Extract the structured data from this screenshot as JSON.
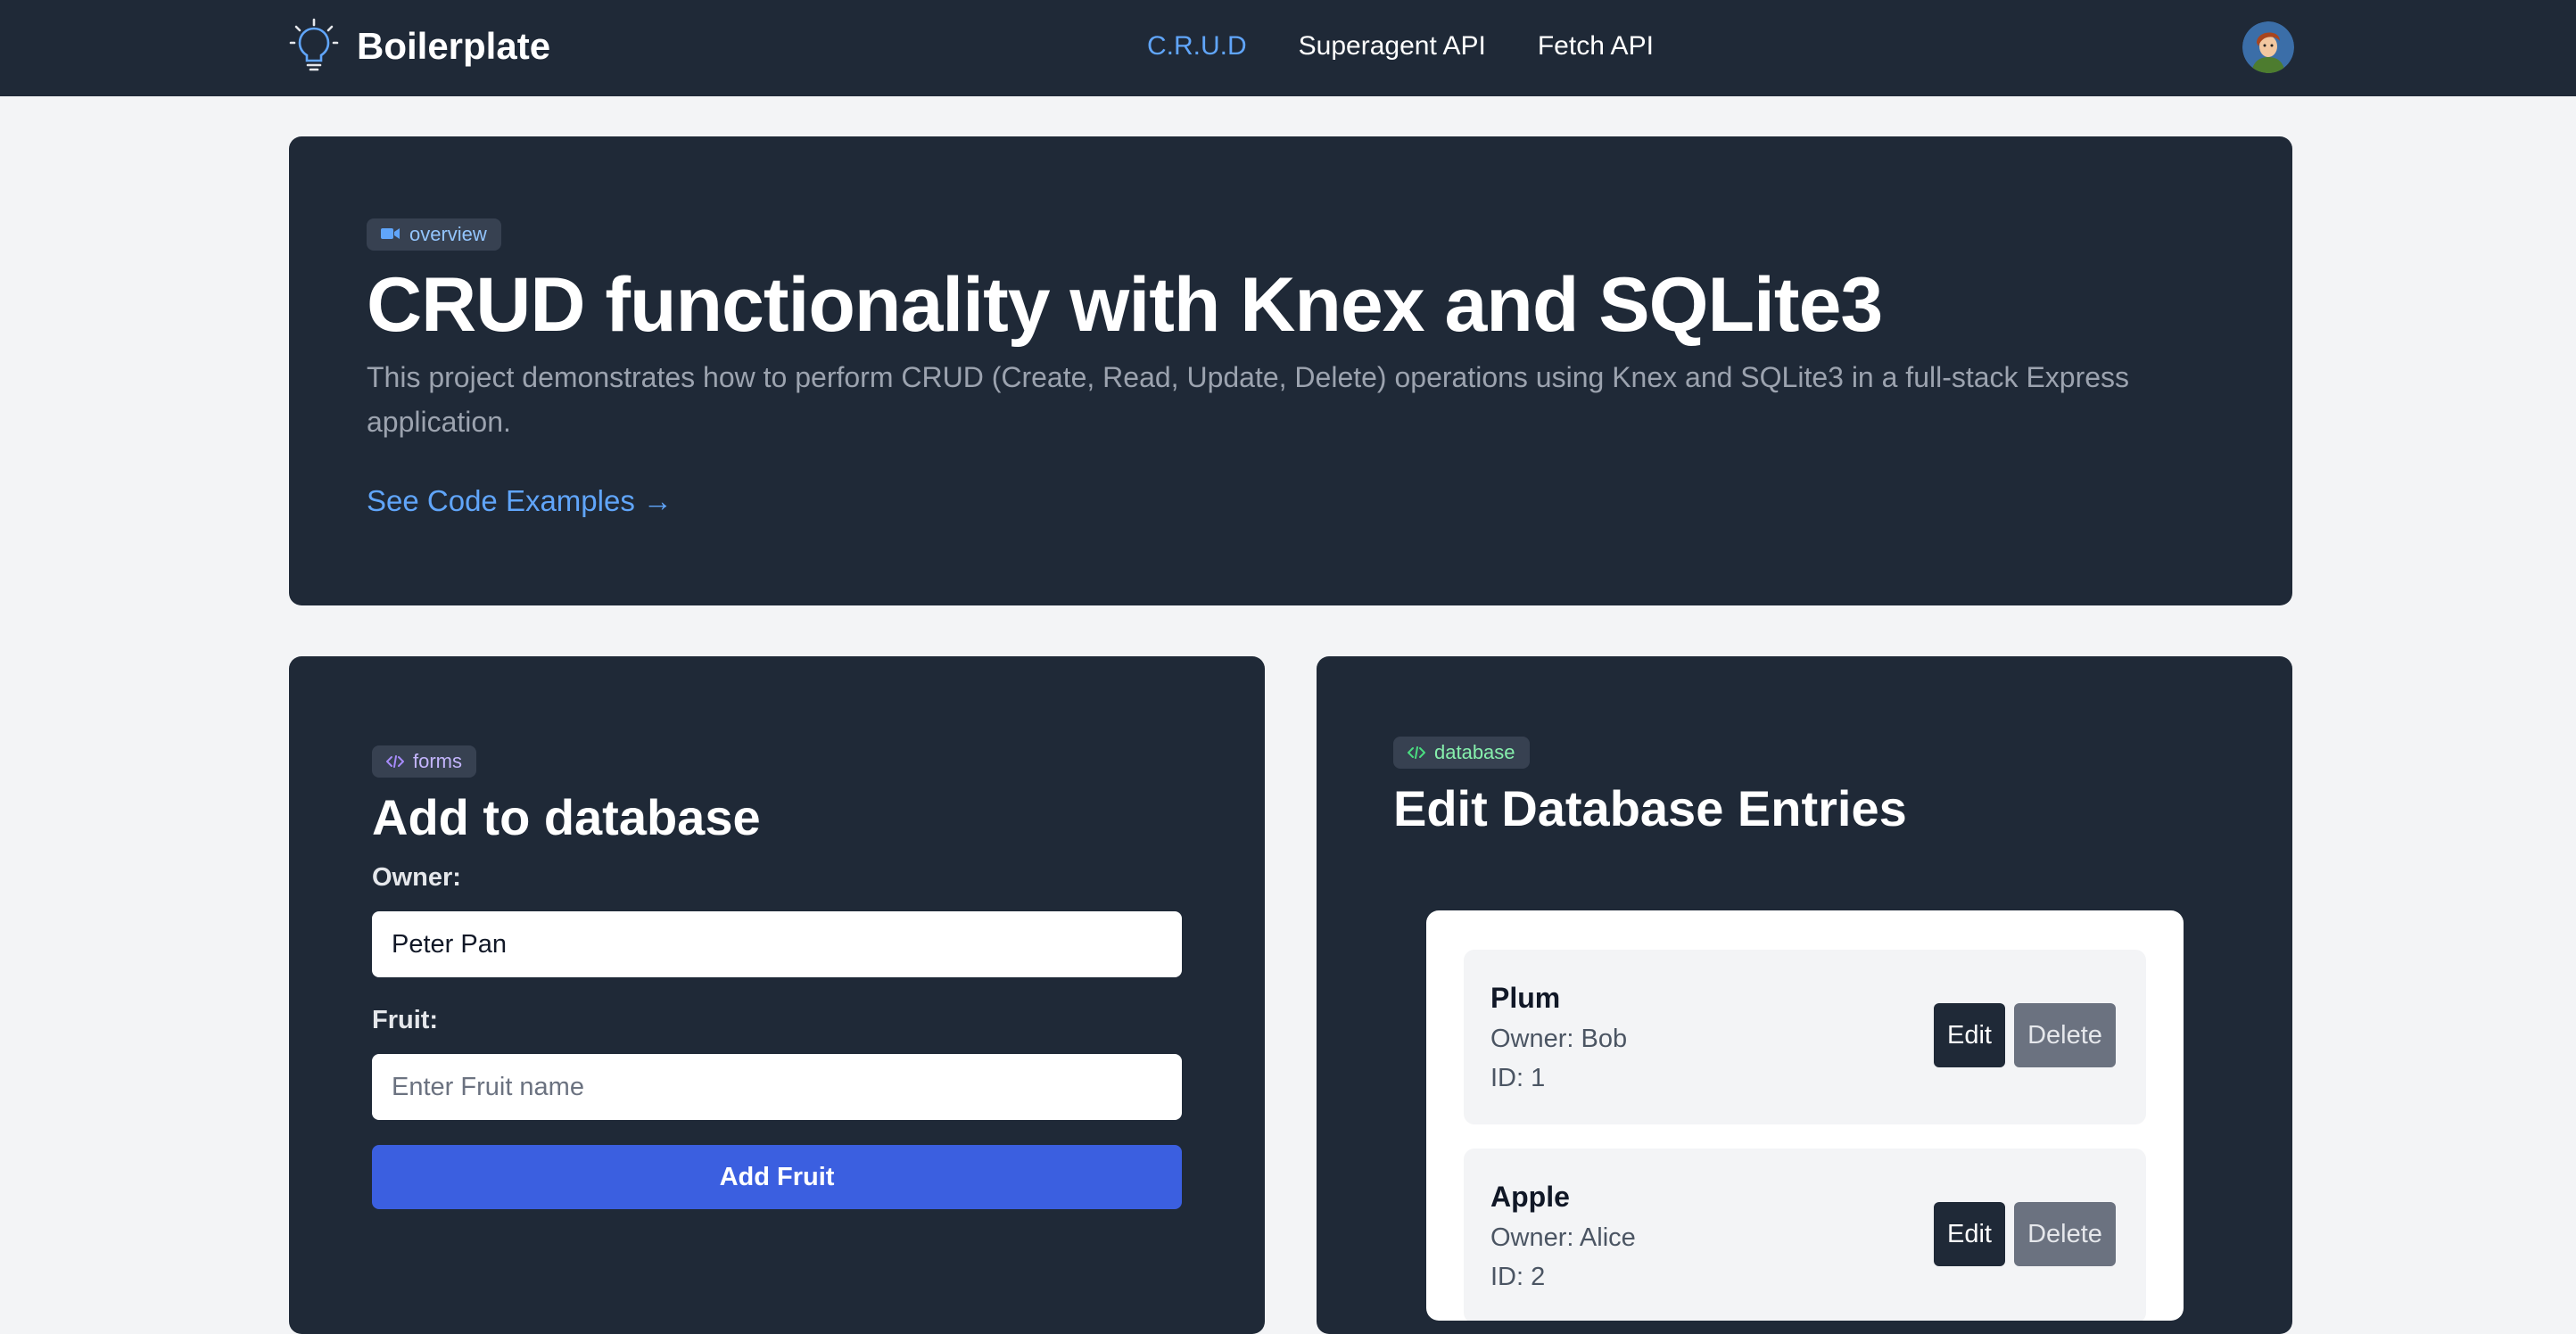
{
  "nav": {
    "brand": "Boilerplate",
    "links": [
      {
        "label": "C.R.U.D",
        "active": true
      },
      {
        "label": "Superagent API",
        "active": false
      },
      {
        "label": "Fetch API",
        "active": false
      }
    ]
  },
  "hero": {
    "badge": "overview",
    "title": "CRUD functionality with Knex and SQLite3",
    "description": "This project demonstrates how to perform CRUD (Create, Read, Update, Delete) operations using Knex and SQLite3 in a full-stack Express application.",
    "link": "See Code Examples →"
  },
  "form": {
    "badge": "forms",
    "title": "Add to database",
    "owner_label": "Owner:",
    "owner_value": "Peter Pan",
    "fruit_label": "Fruit:",
    "fruit_placeholder": "Enter Fruit name",
    "submit_label": "Add Fruit"
  },
  "database": {
    "badge": "database",
    "title": "Edit Database Entries",
    "edit_label": "Edit",
    "delete_label": "Delete",
    "entries": [
      {
        "name": "Plum",
        "owner": "Owner: Bob",
        "id": "ID: 1"
      },
      {
        "name": "Apple",
        "owner": "Owner: Alice",
        "id": "ID: 2"
      }
    ]
  },
  "colors": {
    "nav_bg": "#1f2937",
    "accent": "#60a5fa",
    "button_primary": "#3b5fe0",
    "page_bg": "#f3f4f6"
  }
}
